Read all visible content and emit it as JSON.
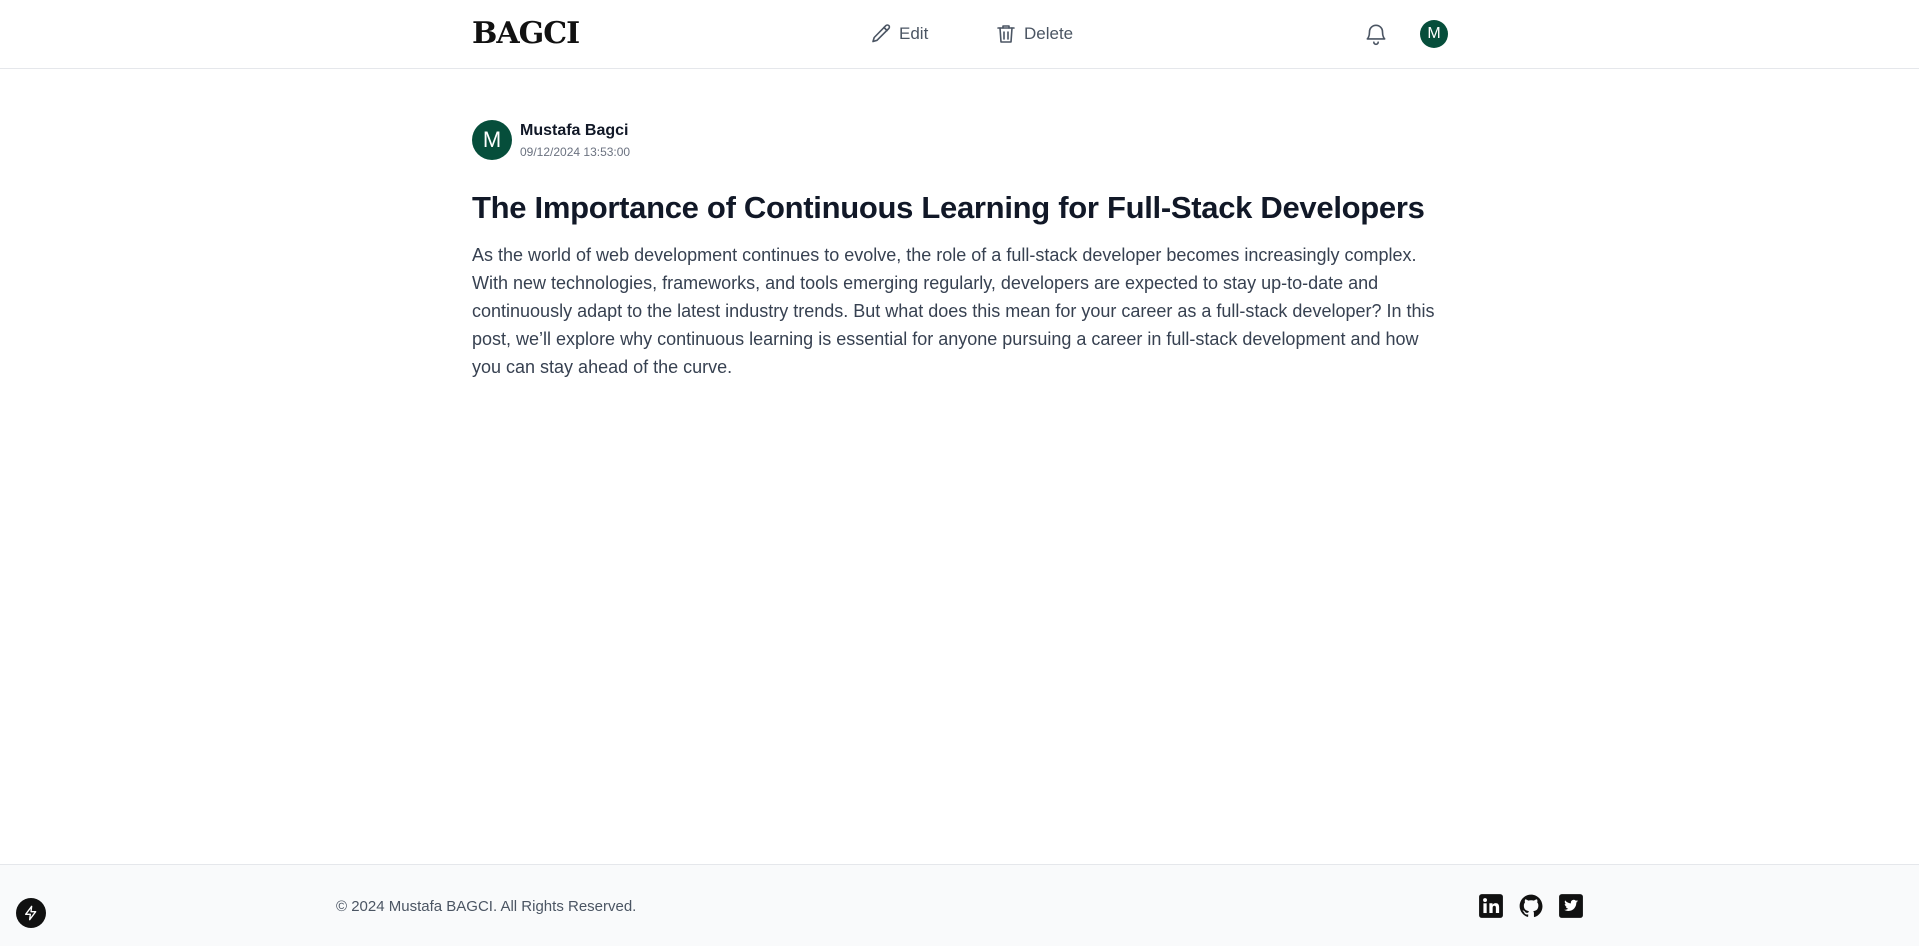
{
  "header": {
    "logo": "BAGCI",
    "edit_label": "Edit",
    "delete_label": "Delete",
    "avatar_initial": "M"
  },
  "post": {
    "author_initial": "M",
    "author_name": "Mustafa Bagci",
    "date": "09/12/2024 13:53:00",
    "title": "The Importance of Continuous Learning for Full-Stack Developers",
    "body": "As the world of web development continues to evolve, the role of a full-stack developer becomes increasingly complex. With new technologies, frameworks, and tools emerging regularly, developers are expected to stay up-to-date and continuously adapt to the latest industry trends. But what does this mean for your career as a full-stack developer? In this post, we’ll explore why continuous learning is essential for anyone pursuing a career in full-stack development and how you can stay ahead of the curve."
  },
  "footer": {
    "copyright": "© 2024 Mustafa BAGCI. All Rights Reserved.",
    "socials": [
      "linkedin-icon",
      "github-icon",
      "twitter-icon"
    ]
  },
  "colors": {
    "accent": "#064e3b",
    "text": "#111827",
    "muted": "#6b7280"
  }
}
